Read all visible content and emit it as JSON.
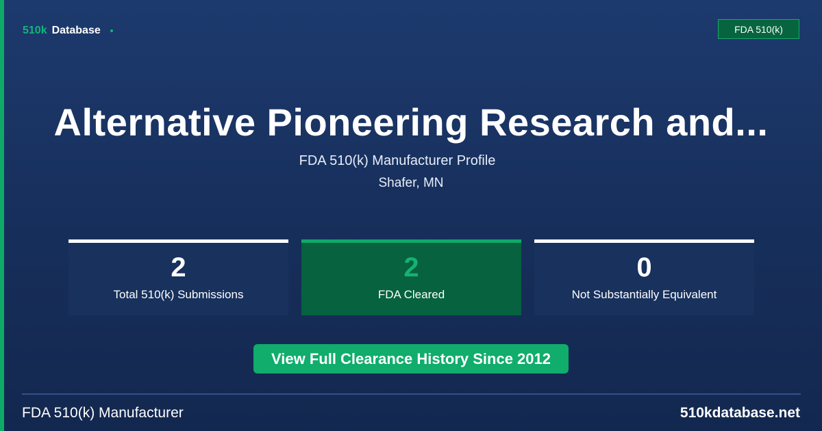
{
  "brand": {
    "prefix": "510k",
    "name": "Database"
  },
  "badge": {
    "label": "FDA 510(k)"
  },
  "header": {
    "title": "Alternative Pioneering Research and...",
    "subtitle": "FDA 510(k) Manufacturer Profile",
    "location": "Shafer, MN"
  },
  "stats": [
    {
      "value": "2",
      "label": "Total 510(k) Submissions"
    },
    {
      "value": "2",
      "label": "FDA Cleared"
    },
    {
      "value": "0",
      "label": "Not Substantially Equivalent"
    }
  ],
  "cta": {
    "label": "View Full Clearance History Since 2012"
  },
  "footer": {
    "left": "FDA 510(k) Manufacturer",
    "right": "510kdatabase.net"
  },
  "colors": {
    "background": "#1b3668",
    "accent": "#10ad6c",
    "stat_card": "#18315d",
    "highlight_card": "#06623f"
  }
}
